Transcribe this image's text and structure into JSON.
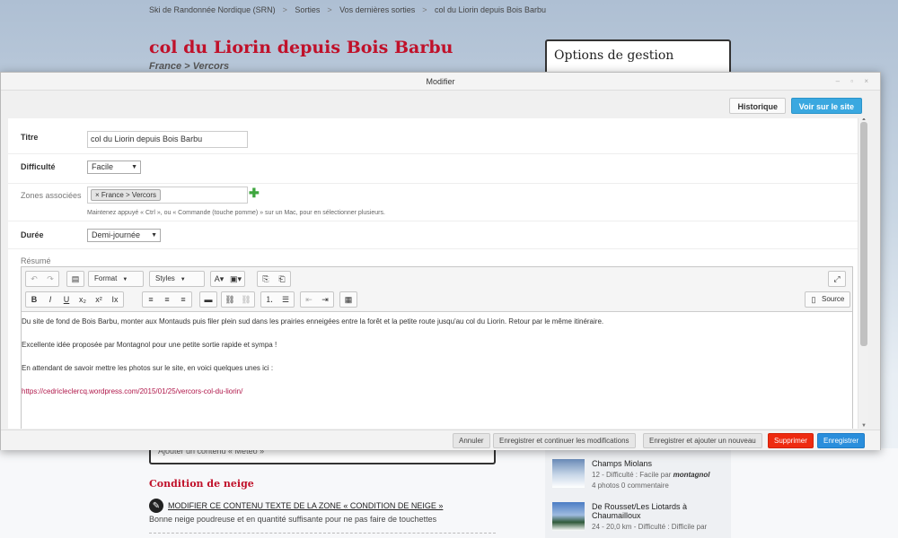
{
  "breadcrumb": {
    "items": [
      "Ski de Randonnée Nordique (SRN)",
      "Sorties",
      "Vos dernières sorties",
      "col du Liorin depuis Bois Barbu"
    ],
    "separator": ">"
  },
  "page": {
    "title": "col du Liorin depuis Bois Barbu",
    "subtitle": "France > Vercors",
    "options_title": "Options de gestion",
    "meteo_link": "Ajouter un contenu « Météo »",
    "neige_title": "Condition de neige",
    "neige_edit": "Modifier ce contenu texte de la zone « Condition de neige »",
    "neige_text": "Bonne neige poudreuse et en quantité suffisante pour ne pas faire de touchettes"
  },
  "sidebar_list": [
    {
      "name": "Champs Miolans",
      "meta": "12 - Difficulté : Facile par",
      "author": "montagnol",
      "stats": "4 photos 0 commentaire"
    },
    {
      "name": "De Rousset/Les Liotards à Chaumailloux",
      "meta": "24 - 20,0 km - Difficulté : Difficile par"
    }
  ],
  "modal": {
    "title": "Modifier",
    "historique": "Historique",
    "voir": "Voir sur le site",
    "titre_label": "Titre",
    "titre_value": "col du Liorin depuis Bois Barbu",
    "difficulte_label": "Difficulté",
    "difficulte_value": "Facile",
    "zones_label": "Zones associées",
    "zones_tag": "France > Vercors",
    "zones_help": "Maintenez appuyé « Ctrl », ou « Commande (touche pomme) » sur un Mac, pour en sélectionner plusieurs.",
    "duree_label": "Durée",
    "duree_value": "Demi-journée",
    "resume_label": "Résumé"
  },
  "editor": {
    "format": "Format",
    "styles": "Styles",
    "source": "Source",
    "paragraphs": [
      "Du site de fond de Bois Barbu, monter aux Montauds puis filer plein sud dans les prairies enneigées entre la forêt et la petite route jusqu'au col du Liorin. Retour par le même itinéraire.",
      "Excellente idée proposée par Montagnol pour une petite sortie rapide et sympa !",
      "En attendant de savoir mettre les photos sur le site, en voici quelques unes ici :"
    ],
    "link": "https://cedricleclercq.wordpress.com/2015/01/25/vercors-col-du-liorin/"
  },
  "footer": {
    "annuler": "Annuler",
    "continuer": "Enregistrer et continuer les modifications",
    "ajouter": "Enregistrer et ajouter un nouveau",
    "supprimer": "Supprimer",
    "enregistrer": "Enregistrer"
  },
  "colors": {
    "title_red": "#c0112a",
    "primary_blue": "#2a8edc",
    "danger_red": "#ee2b10",
    "link": "#b0174a"
  }
}
